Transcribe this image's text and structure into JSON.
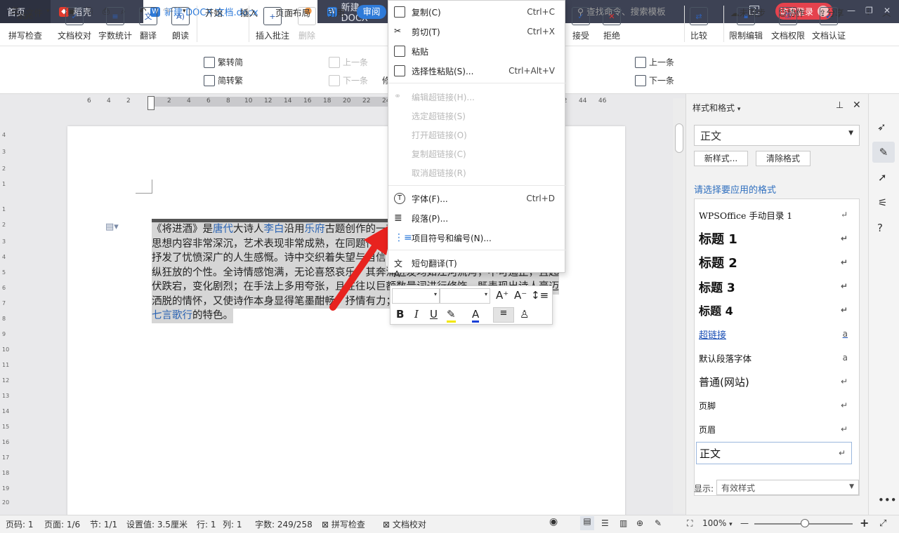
{
  "tabs": [
    {
      "label": "首页"
    },
    {
      "label": "稻壳"
    },
    {
      "label": "新建 DOCX 文档.docx"
    },
    {
      "label": "新建 DOCX"
    }
  ],
  "titlebar": {
    "badge": "2",
    "login": "访客登录"
  },
  "menu": {
    "file": "文件",
    "items": [
      "开始",
      "插入",
      "页面布局",
      "引用",
      "审阅"
    ],
    "search": "查找命令、搜索模板",
    "sync": "未同步",
    "collab": "协作",
    "share": "分享"
  },
  "ribbon": {
    "spell": "拼写检查",
    "proof": "文档校对",
    "wordcount": "字数统计",
    "translate": "翻译",
    "read": "朗读",
    "trad": "繁转简",
    "simp": "简转繁",
    "insert_comment": "插入批注",
    "delete": "删除",
    "prev": "上一条",
    "next": "下一条",
    "accept": "接受",
    "reject": "拒绝",
    "prev2": "上一条",
    "next2": "下一条",
    "compare": "比较",
    "restrict": "限制编辑",
    "perm": "文档权限",
    "cert": "文档认证",
    "modify": "修"
  },
  "ruler": {
    "numbers": [
      "6",
      "4",
      "2",
      "2",
      "4",
      "6",
      "8",
      "10",
      "12",
      "14",
      "16",
      "18",
      "20",
      "22",
      "24",
      "26",
      "28",
      "30",
      "32",
      "34",
      "36",
      "38",
      "40",
      "42",
      "44",
      "46"
    ],
    "vnumbers": [
      "4",
      "3",
      "2",
      "1",
      "1",
      "2",
      "3",
      "4",
      "5",
      "6",
      "7",
      "8",
      "9",
      "10",
      "11",
      "12",
      "13",
      "14",
      "15",
      "16",
      "17",
      "18",
      "19",
      "20",
      "21"
    ]
  },
  "document": {
    "l1a": "《将进酒》是",
    "l1b": "唐代",
    "l1c": "大诗人",
    "l1d": "李白",
    "l1e": "沿用",
    "l1f": "乐府",
    "l1g": "古题创作的一首",
    "l2": "思想内容非常深沉，艺术表现非常成熟，在同题作品",
    "l3": "抒发了忧愤深广的人生感慨。诗中交织着失望与自信",
    "l4": "纵狂放的个性。全诗情感饱满，无论喜怒哀乐，其奔涌迸发均如江河流泻，不可遏止，且起",
    "l5": "伏跌宕，变化剧烈；在手法上多用夸张，且往往以巨额数量词进行修饰，既表现出诗人豪迈",
    "l6": "洒脱的情怀，又使诗作本身显得笔墨酣畅，抒情有力；在",
    "l7a": "七言歌行",
    "l7b": "的特色。"
  },
  "context_menu": {
    "copy": "复制(C)",
    "copy_sc": "Ctrl+C",
    "cut": "剪切(T)",
    "cut_sc": "Ctrl+X",
    "paste": "粘贴",
    "paste_special": "选择性粘贴(S)...",
    "paste_special_sc": "Ctrl+Alt+V",
    "edit_link": "编辑超链接(H)...",
    "select_link": "选定超链接(S)",
    "open_link": "打开超链接(O)",
    "copy_link": "复制超链接(C)",
    "remove_link": "取消超链接(R)",
    "font": "字体(F)...",
    "font_sc": "Ctrl+D",
    "paragraph": "段落(P)...",
    "bullets": "项目符号和编号(N)...",
    "translate": "短句翻译(T)"
  },
  "mini_toolbar": {
    "bold": "B",
    "italic": "I",
    "underline": "U",
    "grow": "A⁺",
    "shrink": "A⁻",
    "font_color": "A"
  },
  "styles_pane": {
    "title": "样式和格式",
    "current": "正文",
    "new_style": "新样式...",
    "clear": "清除格式",
    "subtitle": "请选择要应用的格式",
    "items": [
      {
        "label": "WPSOffice 手动目录 1",
        "mark": "↵"
      },
      {
        "label": "标题 1",
        "mark": "↵"
      },
      {
        "label": "标题 2",
        "mark": "↵"
      },
      {
        "label": "标题 3",
        "mark": "↵"
      },
      {
        "label": "标题 4",
        "mark": "↵"
      },
      {
        "label": "超链接",
        "mark": "a"
      },
      {
        "label": "默认段落字体",
        "mark": "a"
      },
      {
        "label": "普通(网站)",
        "mark": "↵"
      },
      {
        "label": "页脚",
        "mark": "↵"
      },
      {
        "label": "页眉",
        "mark": "↵"
      },
      {
        "label": "正文",
        "mark": "↵"
      }
    ],
    "show_label": "显示:",
    "show_value": "有效样式"
  },
  "status": {
    "page_code": "页码: 1",
    "page": "页面: 1/6",
    "section": "节: 1/1",
    "setting": "设置值: 3.5厘米",
    "row": "行: 1",
    "col": "列: 1",
    "chars": "字数: 249/258",
    "spell": "拼写检查",
    "proof": "文档校对",
    "zoom": "100%"
  },
  "colors": {
    "accent": "#2f7bd9",
    "tabbar": "#3d4254",
    "login": "#e5424d",
    "arrow": "#e8231f"
  }
}
